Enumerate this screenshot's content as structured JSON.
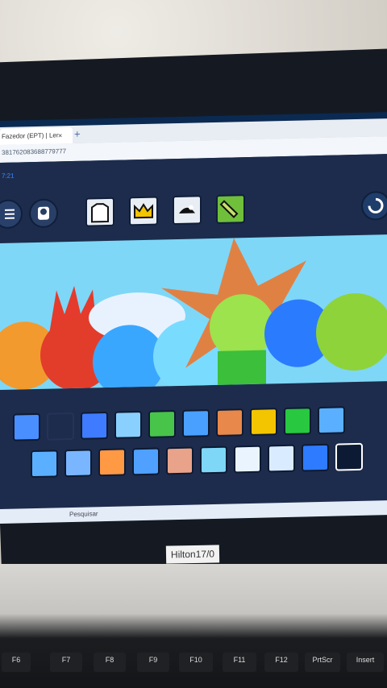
{
  "browser": {
    "tab_title": "Fazedor (EPT) | Ler",
    "tab_close": "×",
    "new_tab": "+",
    "address": "381762083688779777",
    "page_sub": "7:21"
  },
  "toolbar": {
    "icons": [
      "menu-icon",
      "character-icon",
      "hanger-icon",
      "crown-icon",
      "hat-icon",
      "paint-tube-icon",
      "reset-icon"
    ]
  },
  "tray": {
    "row1": [
      "face-1",
      "face-2",
      "face-3",
      "face-4",
      "flower",
      "face-5",
      "face-6",
      "face-7",
      "grass",
      "glasses"
    ],
    "row2": [
      "spiky",
      "face-8",
      "face-9",
      "face-10",
      "hair",
      "smile",
      "m-face",
      "bowtie",
      "blob",
      "blank"
    ]
  },
  "taskbar": {
    "search": "Pesquisar"
  },
  "sticker": {
    "text": "Hilton17/0"
  },
  "keyboard": {
    "keys": [
      "F6",
      "F7",
      "F8",
      "F9",
      "F10",
      "F11",
      "F12",
      "PrtScr",
      "Insert"
    ]
  }
}
